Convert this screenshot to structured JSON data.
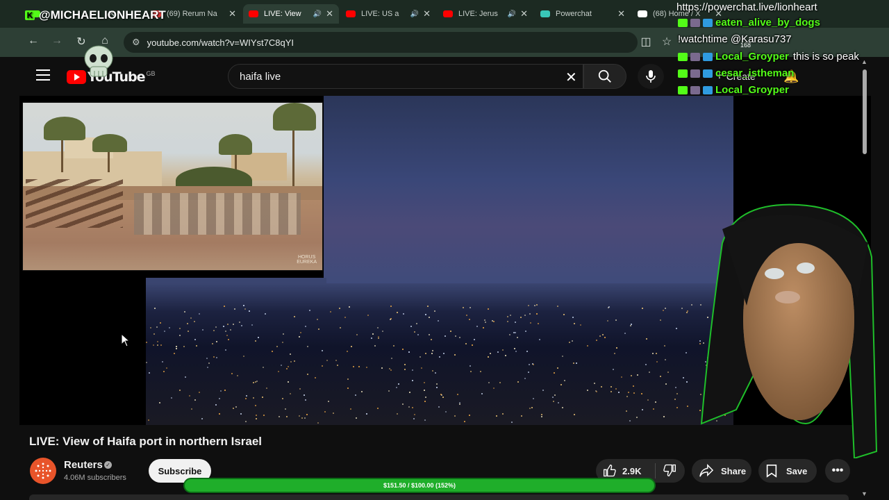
{
  "browser": {
    "tabs": [
      {
        "title": "",
        "favicon_color": "#53fc18"
      },
      {
        "title": "(69) Rerum Na",
        "favicon_color": "#e03a3a"
      },
      {
        "title": "LIVE: View",
        "favicon_color": "#ff0000",
        "active": true
      },
      {
        "title": "LIVE: US a",
        "favicon_color": "#ff0000"
      },
      {
        "title": "LIVE: Jerus",
        "favicon_color": "#ff0000"
      },
      {
        "title": "Powerchat",
        "favicon_color": "#39c7b8"
      },
      {
        "title": "(68) Home / X",
        "favicon_color": "#ffffff"
      }
    ],
    "url": "youtube.com/watch?v=WIYst7C8qYI"
  },
  "youtube": {
    "logo_text": "YouTube",
    "logo_country": "GB",
    "search_value": "haifa live",
    "create_label": "Create"
  },
  "video": {
    "title": "LIVE: View of Haifa port in northern Israel",
    "overlay_watermark": "HORUS\nEUREKA"
  },
  "channel": {
    "name": "Reuters",
    "subscribers": "4.06M subscribers",
    "subscribe_label": "Subscribe"
  },
  "actions": {
    "like_count": "2.9K",
    "share_label": "Share",
    "save_label": "Save"
  },
  "stream": {
    "handle": "@MICHAELIONHEART",
    "powerchat_url": "https://powerchat.live/lionheart",
    "notification_count": "168",
    "chat": [
      {
        "user": "eaten_alive_by_dogs",
        "message": ""
      },
      {
        "user": "",
        "message": "!watchtime @Karasu737"
      },
      {
        "user": "Local_Groyper",
        "message": "this is so peak"
      },
      {
        "user": "cesar_istheman",
        "message": ""
      },
      {
        "user": "Local_Groyper",
        "message": ""
      }
    ],
    "goal_text": "$151.50 / $100.00 (152%)",
    "goal_progress": 1.0
  },
  "colors": {
    "kick_green": "#53fc18",
    "youtube_red": "#ff0000",
    "goal_green": "#1fae2a"
  }
}
